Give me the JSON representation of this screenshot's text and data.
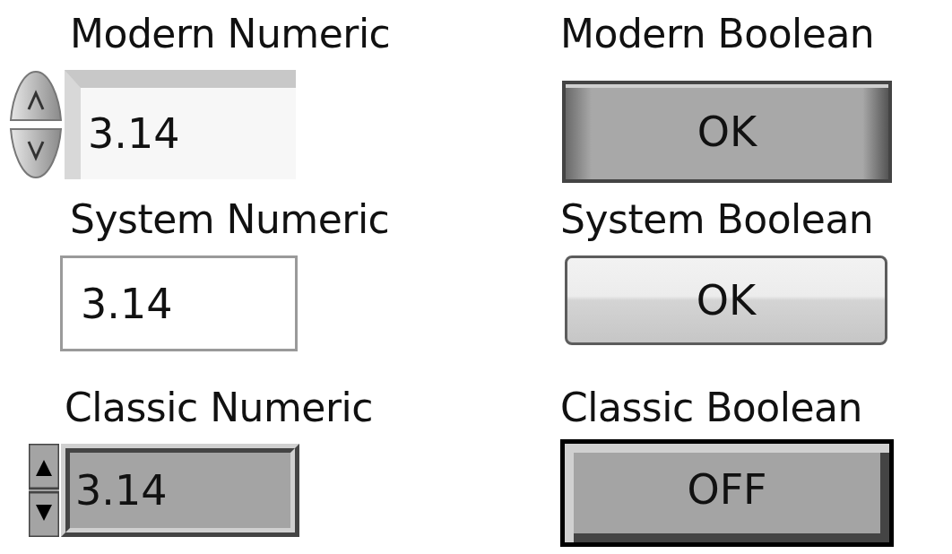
{
  "numerics": [
    {
      "kind": "modern",
      "label": "Modern Numeric",
      "value": "3.14"
    },
    {
      "kind": "system",
      "label": "System Numeric",
      "value": "3.14"
    },
    {
      "kind": "classic",
      "label": "Classic Numeric",
      "value": "3.14"
    }
  ],
  "booleans": [
    {
      "kind": "modern",
      "label": "Modern Boolean",
      "text": "OK"
    },
    {
      "kind": "system",
      "label": "System Boolean",
      "text": "OK"
    },
    {
      "kind": "classic",
      "label": "Classic Boolean",
      "text": "OFF"
    }
  ]
}
